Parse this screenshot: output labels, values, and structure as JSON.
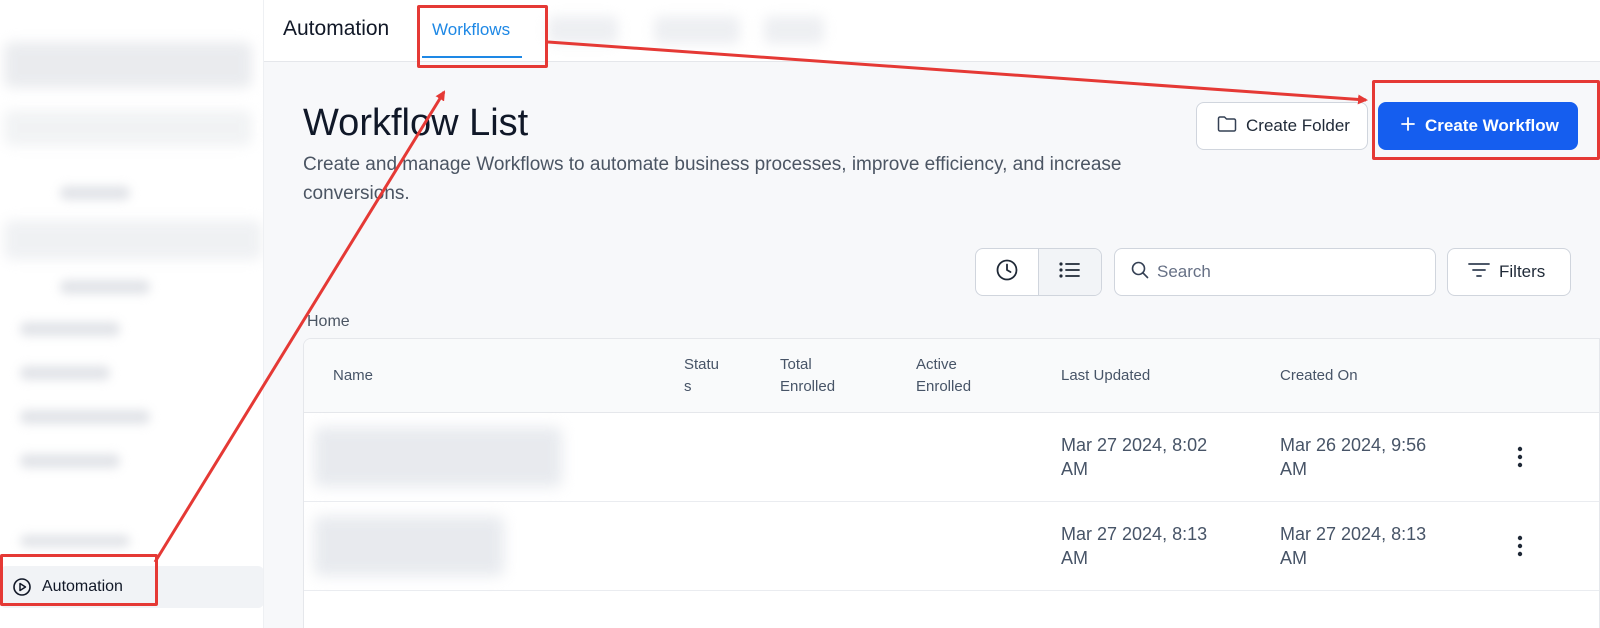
{
  "header": {
    "app_title": "Automation",
    "active_tab": "Workflows"
  },
  "sidebar": {
    "active_item": "Automation"
  },
  "page": {
    "title": "Workflow List",
    "description": "Create and manage Workflows to automate business processes, improve efficiency, and increase conversions.",
    "create_folder_label": "Create Folder",
    "create_workflow_label": "Create Workflow",
    "search_placeholder": "Search",
    "filters_label": "Filters",
    "breadcrumb": "Home"
  },
  "table": {
    "columns": {
      "name": "Name",
      "status_1": "Statu",
      "status_2": "s",
      "total_1": "Total",
      "total_2": "Enrolled",
      "active_1": "Active",
      "active_2": "Enrolled",
      "last_updated": "Last Updated",
      "created_on": "Created On"
    },
    "rows": [
      {
        "last_updated_1": "Mar 27 2024, 8:02",
        "last_updated_2": "AM",
        "created_on_1": "Mar 26 2024, 9:56",
        "created_on_2": "AM"
      },
      {
        "last_updated_1": "Mar 27 2024, 8:13",
        "last_updated_2": "AM",
        "created_on_1": "Mar 27 2024, 8:13",
        "created_on_2": "AM"
      }
    ]
  },
  "colors": {
    "primary": "#155eef",
    "tab_active": "#1e88e5",
    "annotation": "#e53935"
  },
  "icons": {
    "automation": "play-circle-icon",
    "folder": "folder-icon",
    "plus": "plus-icon",
    "clock": "clock-icon",
    "list": "list-icon",
    "search": "search-icon",
    "filters": "filter-lines-icon",
    "row_menu": "more-vertical-icon"
  }
}
